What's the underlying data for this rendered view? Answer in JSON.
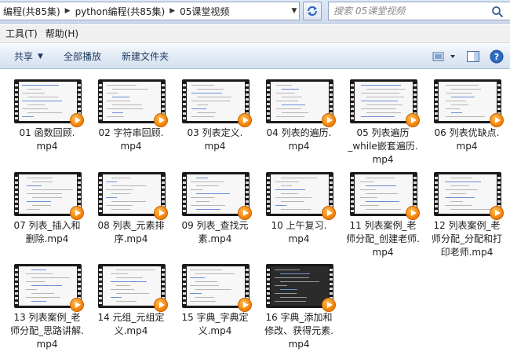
{
  "address": {
    "crumbs": [
      "编程(共85集)",
      "python编程(共85集)",
      "05课堂视频"
    ],
    "search_placeholder": "搜索 05课堂视频"
  },
  "menu": {
    "tools": "工具(T)",
    "help": "帮助(H)"
  },
  "commands": {
    "share": "共享",
    "play_all": "全部播放",
    "new_folder": "新建文件夹"
  },
  "icons": [
    "refresh-icon",
    "search-icon",
    "view-options-icon",
    "preview-pane-icon",
    "help-icon",
    "video-play-icon"
  ],
  "accent_colors": {
    "play_badge": "#f07d00",
    "toolbar_text": "#1e3a5f"
  },
  "files": [
    {
      "name_line1": "01 函数回顾.",
      "name_line2": "mp4",
      "name_line3": ""
    },
    {
      "name_line1": "02 字符串回顾.",
      "name_line2": "mp4",
      "name_line3": ""
    },
    {
      "name_line1": "03 列表定义.",
      "name_line2": "mp4",
      "name_line3": ""
    },
    {
      "name_line1": "04 列表的遍历.",
      "name_line2": "mp4",
      "name_line3": ""
    },
    {
      "name_line1": "05 列表遍历",
      "name_line2": "_while嵌套遍历.",
      "name_line3": "mp4"
    },
    {
      "name_line1": "06 列表优缺点.",
      "name_line2": "mp4",
      "name_line3": ""
    },
    {
      "name_line1": "07 列表_插入和",
      "name_line2": "删除.mp4",
      "name_line3": ""
    },
    {
      "name_line1": "08 列表_元素排",
      "name_line2": "序.mp4",
      "name_line3": ""
    },
    {
      "name_line1": "09 列表_查找元",
      "name_line2": "素.mp4",
      "name_line3": ""
    },
    {
      "name_line1": "10 上午复习.",
      "name_line2": "mp4",
      "name_line3": ""
    },
    {
      "name_line1": "11 列表案例_老",
      "name_line2": "师分配_创建老师.",
      "name_line3": "mp4"
    },
    {
      "name_line1": "12 列表案例_老",
      "name_line2": "师分配_分配和打",
      "name_line3": "印老师.mp4"
    },
    {
      "name_line1": "13 列表案例_老",
      "name_line2": "师分配_思路讲解.",
      "name_line3": "mp4"
    },
    {
      "name_line1": "14 元组_元组定",
      "name_line2": "义.mp4",
      "name_line3": ""
    },
    {
      "name_line1": "15 字典_字典定",
      "name_line2": "义.mp4",
      "name_line3": ""
    },
    {
      "name_line1": "16 字典_添加和",
      "name_line2": "修改、获得元素.",
      "name_line3": "mp4"
    }
  ]
}
